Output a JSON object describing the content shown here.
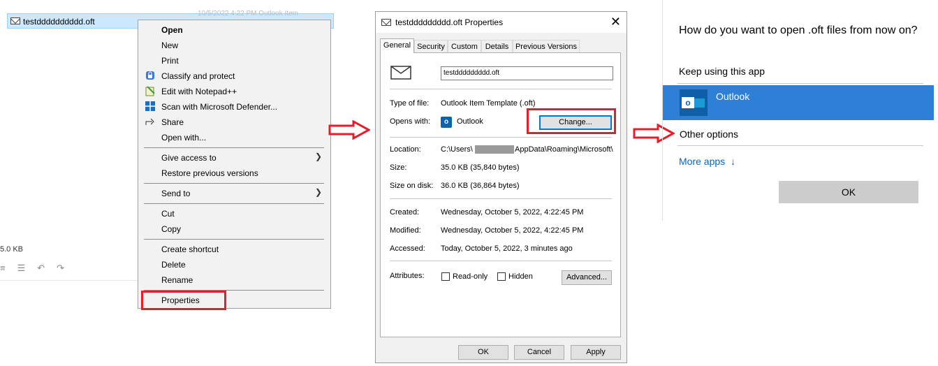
{
  "explorer": {
    "file_name": "testdddddddddd.oft",
    "faded_detail": "10/5/2022 4:22 PM      Outlook Item",
    "size_fragment": "5.0 KB"
  },
  "context_menu": {
    "items": [
      {
        "label": "Open",
        "bold": true
      },
      {
        "label": "New"
      },
      {
        "label": "Print"
      },
      {
        "label": "Classify and protect",
        "icon": "shield-lock-icon"
      },
      {
        "label": "Edit with Notepad++",
        "icon": "notepad-icon"
      },
      {
        "label": "Scan with Microsoft Defender...",
        "icon": "defender-icon"
      },
      {
        "label": "Share",
        "icon": "share-icon"
      },
      {
        "label": "Open with..."
      },
      {
        "label": "Give access to",
        "submenu": true
      },
      {
        "label": "Restore previous versions"
      },
      {
        "label": "Send to",
        "submenu": true
      },
      {
        "label": "Cut"
      },
      {
        "label": "Copy"
      },
      {
        "label": "Create shortcut"
      },
      {
        "label": "Delete"
      },
      {
        "label": "Rename"
      },
      {
        "label": "Properties",
        "highlighted": true
      }
    ]
  },
  "properties_dialog": {
    "title": "testddddddddd.oft Properties",
    "tabs": [
      "General",
      "Security",
      "Custom",
      "Details",
      "Previous Versions"
    ],
    "active_tab": "General",
    "file_name_value": "testddddddddd.oft",
    "type_label": "Type of file:",
    "type_value": "Outlook Item Template (.oft)",
    "opens_label": "Opens with:",
    "opens_value": "Outlook",
    "change_button": "Change...",
    "location_label": "Location:",
    "location_prefix": "C:\\Users\\",
    "location_suffix": "AppData\\Roaming\\Microsoft\\",
    "size_label": "Size:",
    "size_value": "35.0 KB (35,840 bytes)",
    "size_on_disk_label": "Size on disk:",
    "size_on_disk_value": "36.0 KB (36,864 bytes)",
    "created_label": "Created:",
    "created_value": "Wednesday, October 5, 2022, 4:22:45 PM",
    "modified_label": "Modified:",
    "modified_value": "Wednesday, October 5, 2022, 4:22:45 PM",
    "accessed_label": "Accessed:",
    "accessed_value": "Today, October 5, 2022, 3 minutes ago",
    "attributes_label": "Attributes:",
    "readonly_label": "Read-only",
    "hidden_label": "Hidden",
    "advanced_button": "Advanced...",
    "ok_button": "OK",
    "cancel_button": "Cancel",
    "apply_button": "Apply"
  },
  "open_with": {
    "question": "How do you want to open .oft files from now on?",
    "keep_using": "Keep using this app",
    "selected_app": "Outlook",
    "other_options": "Other options",
    "more_apps": "More apps",
    "more_apps_arrow": "↓",
    "ok_button": "OK"
  },
  "colors": {
    "highlight_red": "#e61e2b",
    "selection_blue": "#2e7fd6",
    "link_blue": "#0066cc"
  }
}
